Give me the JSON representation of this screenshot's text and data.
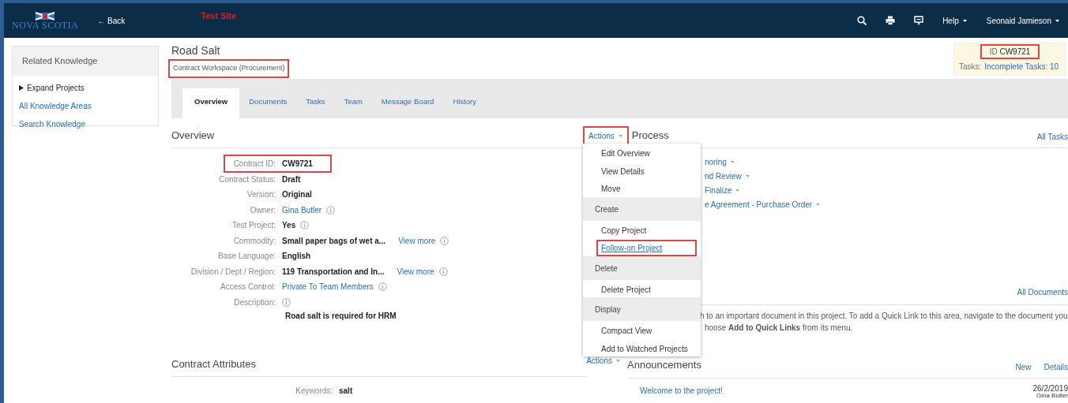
{
  "navbar": {
    "logo_text": "NOVA SCOTIA",
    "back": "← Back",
    "site_label": "Test Site",
    "help": "Help",
    "user": "Seonaid Jamieson"
  },
  "sidebar": {
    "title": "Related Knowledge",
    "items": [
      {
        "label": "Expand Projects",
        "kind": "toggle"
      },
      {
        "label": "All Knowledge Areas",
        "kind": "link"
      },
      {
        "label": "Search Knowledge",
        "kind": "link"
      }
    ]
  },
  "header": {
    "title": "Road Salt",
    "subtitle": "Contract Workspace (Procurement)",
    "subtitle_highlighted": true,
    "id_label": "ID",
    "id_value": "CW9721",
    "id_highlighted": true,
    "tasks_label": "Tasks:",
    "tasks_link": "Incomplete Tasks: 10"
  },
  "tabs": [
    {
      "label": "Overview",
      "selected": true
    },
    {
      "label": "Documents",
      "selected": false
    },
    {
      "label": "Tasks",
      "selected": false
    },
    {
      "label": "Team",
      "selected": false
    },
    {
      "label": "Message Board",
      "selected": false
    },
    {
      "label": "History",
      "selected": false
    }
  ],
  "overview": {
    "title": "Overview",
    "actions": "Actions",
    "actions_highlighted": true,
    "fields": [
      {
        "label": "Contract ID:",
        "value": "CW9721",
        "kind": "text",
        "info": false,
        "highlighted": true
      },
      {
        "label": "Contract Status:",
        "value": "Draft",
        "kind": "text",
        "info": false,
        "highlighted": false
      },
      {
        "label": "Version:",
        "value": "Original",
        "kind": "text",
        "info": false,
        "highlighted": false
      },
      {
        "label": "Owner:",
        "value": "Gina Butler",
        "kind": "link",
        "info": true,
        "highlighted": false
      },
      {
        "label": "Test Project:",
        "value": "Yes",
        "kind": "text",
        "info": true,
        "highlighted": false
      },
      {
        "label": "Commodity:",
        "value": "Small paper bags of wet a...",
        "kind": "text",
        "view_more": "View more",
        "info": true,
        "highlighted": false
      },
      {
        "label": "Base Language:",
        "value": "English",
        "kind": "text",
        "info": false,
        "highlighted": false
      },
      {
        "label": "Division / Dept / Region:",
        "value": "119 Transportation and In...",
        "kind": "text",
        "view_more": "View more",
        "info": true,
        "highlighted": false
      },
      {
        "label": "Access Control:",
        "value": "Private To Team Members",
        "kind": "link",
        "info": true,
        "highlighted": false
      },
      {
        "label": "Description:",
        "value": "Road salt is required for HRM",
        "kind": "description",
        "info": true,
        "highlighted": false
      }
    ]
  },
  "actions_menu": [
    {
      "label": "Edit Overview",
      "kind": "item",
      "highlighted": false
    },
    {
      "label": "View Details",
      "kind": "item",
      "highlighted": false
    },
    {
      "label": "Move",
      "kind": "item",
      "highlighted": false
    },
    {
      "label": "Create",
      "kind": "header",
      "highlighted": false
    },
    {
      "label": "Copy Project",
      "kind": "item",
      "highlighted": false
    },
    {
      "label": "Follow-on Project",
      "kind": "link",
      "highlighted": true
    },
    {
      "label": "Delete",
      "kind": "header",
      "highlighted": false
    },
    {
      "label": "Delete Project",
      "kind": "item",
      "highlighted": false
    },
    {
      "label": "Display",
      "kind": "header",
      "highlighted": false
    },
    {
      "label": "Compact View",
      "kind": "item",
      "highlighted": false
    },
    {
      "label": "Add to Watched Projects",
      "kind": "item",
      "highlighted": false
    }
  ],
  "process": {
    "title": "Process",
    "all_tasks": "All Tasks",
    "items": [
      "noring",
      "nd Review",
      "Finalize",
      "e Agreement - Purchase Order"
    ]
  },
  "documents": {
    "all_documents": "All Documents",
    "text_lines": [
      "h to an important document in this project. To add a Quick Link to this area, navigate to the document you",
      "hoose **Add to Quick Links** from its menu."
    ]
  },
  "contract_attributes": {
    "title": "Contract Attributes",
    "actions": "Actions",
    "fields": [
      {
        "label": "Keywords:",
        "value": "salt"
      }
    ]
  },
  "announcements": {
    "title": "Announcements",
    "new": "New",
    "details": "Details",
    "items": [
      {
        "title": "Welcome to the project!",
        "date": "26/2/2019",
        "author": "Gina Butler"
      }
    ]
  }
}
